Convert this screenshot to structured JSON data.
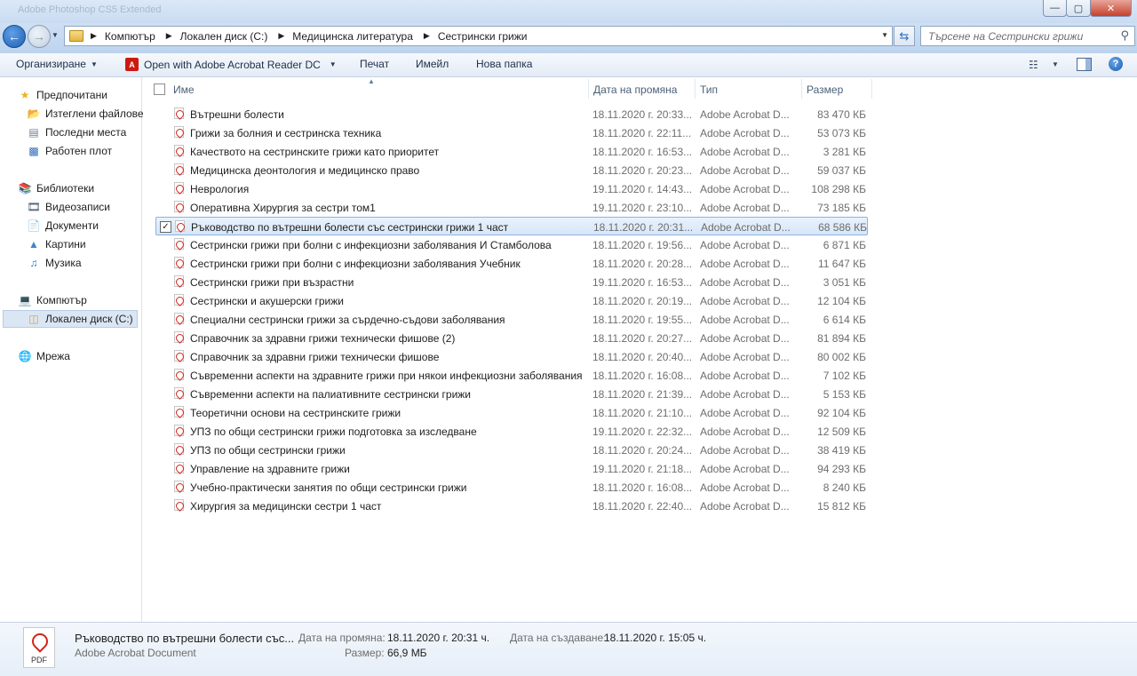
{
  "window": {
    "title": "Adobe Photoshop CS5 Extended",
    "minimize": "—",
    "maximize": "▢",
    "close": "✕"
  },
  "address": {
    "crumbs": [
      "Компютър",
      "Локален диск (C:)",
      "Медицинска литература",
      "Сестрински грижи"
    ],
    "search_placeholder": "Търсене на Сестрински грижи"
  },
  "toolbar": {
    "organize": "Организиране",
    "open_with": "Open with Adobe Acrobat Reader DC",
    "print": "Печат",
    "email": "Имейл",
    "new_folder": "Нова папка"
  },
  "nav": {
    "favorites": "Предпочитани",
    "downloads": "Изтеглени файлове",
    "recent": "Последни места",
    "desktop": "Работен плот",
    "libraries": "Библиотеки",
    "videos": "Видеозаписи",
    "documents": "Документи",
    "pictures": "Картини",
    "music": "Музика",
    "computer": "Компютър",
    "local_disk": "Локален диск (C:)",
    "network": "Мрежа"
  },
  "columns": {
    "name": "Име",
    "date": "Дата на промяна",
    "type": "Тип",
    "size": "Размер"
  },
  "files": [
    {
      "name": "Вътрешни болести",
      "date": "18.11.2020 г. 20:33...",
      "type": "Adobe Acrobat D...",
      "size": "83 470 КБ"
    },
    {
      "name": "Грижи за болния и сестринска техника",
      "date": "18.11.2020 г. 22:11...",
      "type": "Adobe Acrobat D...",
      "size": "53 073 КБ"
    },
    {
      "name": "Качеството на сестринските грижи като приоритет",
      "date": "18.11.2020 г. 16:53...",
      "type": "Adobe Acrobat D...",
      "size": "3 281 КБ"
    },
    {
      "name": "Медицинска деонтология и медицинско право",
      "date": "18.11.2020 г. 20:23...",
      "type": "Adobe Acrobat D...",
      "size": "59 037 КБ"
    },
    {
      "name": "Неврология",
      "date": "19.11.2020 г. 14:43...",
      "type": "Adobe Acrobat D...",
      "size": "108 298 КБ"
    },
    {
      "name": "Оперативна Хирургия за сестри том1",
      "date": "19.11.2020 г. 23:10...",
      "type": "Adobe Acrobat D...",
      "size": "73 185 КБ"
    },
    {
      "name": "Ръководство по  вътрешни болести със сестрински грижи  1 част",
      "date": "18.11.2020 г. 20:31...",
      "type": "Adobe Acrobat D...",
      "size": "68 586 КБ"
    },
    {
      "name": "Сестрински грижи при болни с инфекциозни заболявания И Стамболова",
      "date": "18.11.2020 г. 19:56...",
      "type": "Adobe Acrobat D...",
      "size": "6 871 КБ"
    },
    {
      "name": "Сестрински грижи при болни с инфекциозни заболявания Учебник",
      "date": "18.11.2020 г. 20:28...",
      "type": "Adobe Acrobat D...",
      "size": "11 647 КБ"
    },
    {
      "name": "Сестрински грижи при възрастни",
      "date": "19.11.2020 г. 16:53...",
      "type": "Adobe Acrobat D...",
      "size": "3 051 КБ"
    },
    {
      "name": "Сестрински и акушерски грижи",
      "date": "18.11.2020 г. 20:19...",
      "type": "Adobe Acrobat D...",
      "size": "12 104 КБ"
    },
    {
      "name": "Специални сестрински грижи за сърдечно-съдови заболявания",
      "date": "18.11.2020 г. 19:55...",
      "type": "Adobe Acrobat D...",
      "size": "6 614 КБ"
    },
    {
      "name": "Справочник за здравни грижи технически фишове (2)",
      "date": "18.11.2020 г. 20:27...",
      "type": "Adobe Acrobat D...",
      "size": "81 894 КБ"
    },
    {
      "name": "Справочник за здравни грижи технически фишове",
      "date": "18.11.2020 г. 20:40...",
      "type": "Adobe Acrobat D...",
      "size": "80 002 КБ"
    },
    {
      "name": "Съвременни аспекти на здравните грижи при някои инфекциозни заболявания",
      "date": "18.11.2020 г. 16:08...",
      "type": "Adobe Acrobat D...",
      "size": "7 102 КБ"
    },
    {
      "name": "Съвременни аспекти на палиативните сестрински грижи",
      "date": "18.11.2020 г. 21:39...",
      "type": "Adobe Acrobat D...",
      "size": "5 153 КБ"
    },
    {
      "name": "Теоретични основи на сестринските грижи",
      "date": "18.11.2020 г. 21:10...",
      "type": "Adobe Acrobat D...",
      "size": "92 104 КБ"
    },
    {
      "name": "УПЗ по общи сестрински грижи подготовка за изследване",
      "date": "19.11.2020 г. 22:32...",
      "type": "Adobe Acrobat D...",
      "size": "12 509 КБ"
    },
    {
      "name": "УПЗ по общи сестрински грижи",
      "date": "18.11.2020 г. 20:24...",
      "type": "Adobe Acrobat D...",
      "size": "38 419 КБ"
    },
    {
      "name": "Управление на здравните грижи",
      "date": "19.11.2020 г. 21:18...",
      "type": "Adobe Acrobat D...",
      "size": "94 293 КБ"
    },
    {
      "name": "Учебно-практически занятия по общи сестрински грижи",
      "date": "18.11.2020 г. 16:08...",
      "type": "Adobe Acrobat D...",
      "size": "8 240 КБ"
    },
    {
      "name": "Хирургия за медицински сестри 1 част",
      "date": "18.11.2020 г. 22:40...",
      "type": "Adobe Acrobat D...",
      "size": "15 812 КБ"
    }
  ],
  "selected_index": 6,
  "details": {
    "icon_label": "PDF",
    "filename": "Ръководство по  вътрешни болести със...",
    "filetype": "Adobe Acrobat Document",
    "modified_label": "Дата на промяна:",
    "modified_value": "18.11.2020 г. 20:31 ч.",
    "created_label": "Дата на създаване:",
    "created_value": "18.11.2020 г. 15:05 ч.",
    "size_label": "Размер:",
    "size_value": "66,9 МБ"
  }
}
